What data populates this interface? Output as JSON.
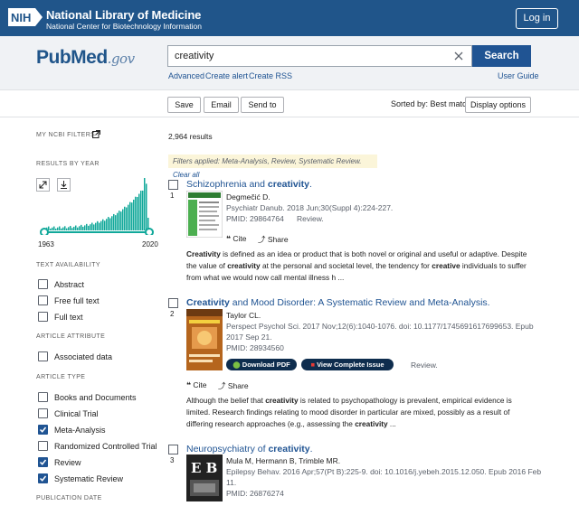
{
  "header": {
    "org_name": "National Library of Medicine",
    "org_sub": "National Center for Biotechnology Information",
    "login_label": "Log in",
    "logo_text": "NIH"
  },
  "search": {
    "logo_pub": "Pub",
    "logo_med": "Med",
    "logo_gov": ".gov",
    "query": "creativity",
    "button_label": "Search",
    "advanced": "Advanced",
    "create_alert": "Create alert",
    "create_rss": "Create RSS",
    "user_guide": "User Guide"
  },
  "toolbar": {
    "save": "Save",
    "email": "Email",
    "send_to": "Send to",
    "sorted_by": "Sorted by: Best match",
    "display_options": "Display options"
  },
  "sidebar": {
    "my_filters": "MY NCBI FILTERS",
    "results_by_year": "RESULTS BY YEAR",
    "year_start": "1963",
    "year_end": "2020",
    "text_availability": "TEXT AVAILABILITY",
    "text_items": [
      {
        "label": "Abstract",
        "checked": false
      },
      {
        "label": "Free full text",
        "checked": false
      },
      {
        "label": "Full text",
        "checked": false
      }
    ],
    "article_attribute": "ARTICLE ATTRIBUTE",
    "attribute_items": [
      {
        "label": "Associated data",
        "checked": false
      }
    ],
    "article_type": "ARTICLE TYPE",
    "type_items": [
      {
        "label": "Books and Documents",
        "checked": false
      },
      {
        "label": "Clinical Trial",
        "checked": false
      },
      {
        "label": "Meta-Analysis",
        "checked": true
      },
      {
        "label": "Randomized Controlled Trial",
        "checked": false
      },
      {
        "label": "Review",
        "checked": true
      },
      {
        "label": "Systematic Review",
        "checked": true
      }
    ],
    "publication_date": "PUBLICATION DATE"
  },
  "results": {
    "count": "2,964 results",
    "filters_prefix": "Filters applied: Meta-Analysis, Review, Systematic Review.",
    "clear_all": "Clear all",
    "cite": "Cite",
    "share": "Share",
    "items": [
      {
        "num": "1",
        "title_a": "Schizophrenia and ",
        "title_b": "creativity",
        "title_c": ".",
        "authors": "Degmečić D.",
        "citation": "Psychiatr Danub. 2018 Jun;30(Suppl 4):224-227.",
        "pmid": "PMID: 29864764",
        "type": "Review.",
        "abstract_lines": [
          [
            "Creativity",
            " is defined as an idea or product that is both novel or original and useful or adaptive. Despite"
          ],
          [
            "the value of ",
            "creativity",
            " at the personal and societal level, the tendency for ",
            "creative",
            " individuals to suffer"
          ],
          [
            "from what we would now call mental illness h ..."
          ]
        ]
      },
      {
        "num": "2",
        "title_a": "Creativity",
        "title_b": " and Mood Disorder: A Systematic Review and Meta-Analysis.",
        "authors": "Taylor CL.",
        "citation_1": "Perspect Psychol Sci. 2017 Nov;12(6):1040-1076. doi: 10.1177/1745691617699653. Epub",
        "citation_2": "2017 Sep 21.",
        "pmid": "PMID: 28934560",
        "download_pdf": "Download PDF",
        "view_issue": "View Complete Issue",
        "type": "Review.",
        "abstract_lines": [
          [
            "Although the belief that ",
            "creativity",
            " is related to psychopathology is prevalent, empirical evidence is"
          ],
          [
            "limited. Research findings relating to mood disorder in particular are mixed, possibly as a result of"
          ],
          [
            "differing research approaches (e.g., assessing the ",
            "creativity",
            " ..."
          ]
        ]
      },
      {
        "num": "3",
        "title_a": "Neuropsychiatry of ",
        "title_b": "creativity",
        "title_c": ".",
        "authors": "Mula M, Hermann B, Trimble MR.",
        "citation_1": "Epilepsy Behav. 2016 Apr;57(Pt B):225-9. doi: 10.1016/j.yebeh.2015.12.050. Epub 2016 Feb",
        "citation_2": "11.",
        "pmid": "PMID: 26876274",
        "thumb_text": "E B"
      }
    ]
  },
  "colors": {
    "nih_blue": "#20558a",
    "link_blue": "#205493",
    "histogram": "#11a89a",
    "filter_banner": "#fbf5d9"
  }
}
